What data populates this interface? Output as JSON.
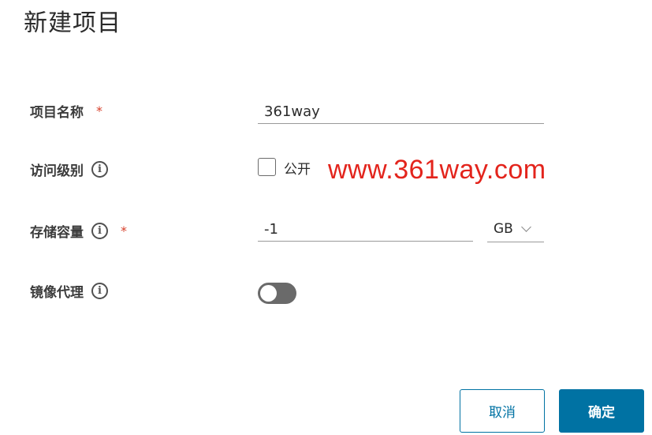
{
  "dialog": {
    "title": "新建项目"
  },
  "form": {
    "project_name": {
      "label": "项目名称",
      "required_mark": "*",
      "value": "361way"
    },
    "access_level": {
      "label": "访问级别",
      "info_icon": "info-icon",
      "public_checkbox_label": "公开",
      "public_checked": false
    },
    "storage_quota": {
      "label": "存储容量",
      "info_icon": "info-icon",
      "required_mark": "*",
      "value": "-1",
      "unit": "GB"
    },
    "proxy_cache": {
      "label": "镜像代理",
      "info_icon": "info-icon",
      "enabled": false
    }
  },
  "watermark": "www.361way.com",
  "buttons": {
    "cancel": "取消",
    "ok": "确定"
  },
  "colors": {
    "primary": "#0072a3",
    "required": "#d7402b",
    "watermark": "#e3241c",
    "toggle_off": "#6a6a6a"
  }
}
